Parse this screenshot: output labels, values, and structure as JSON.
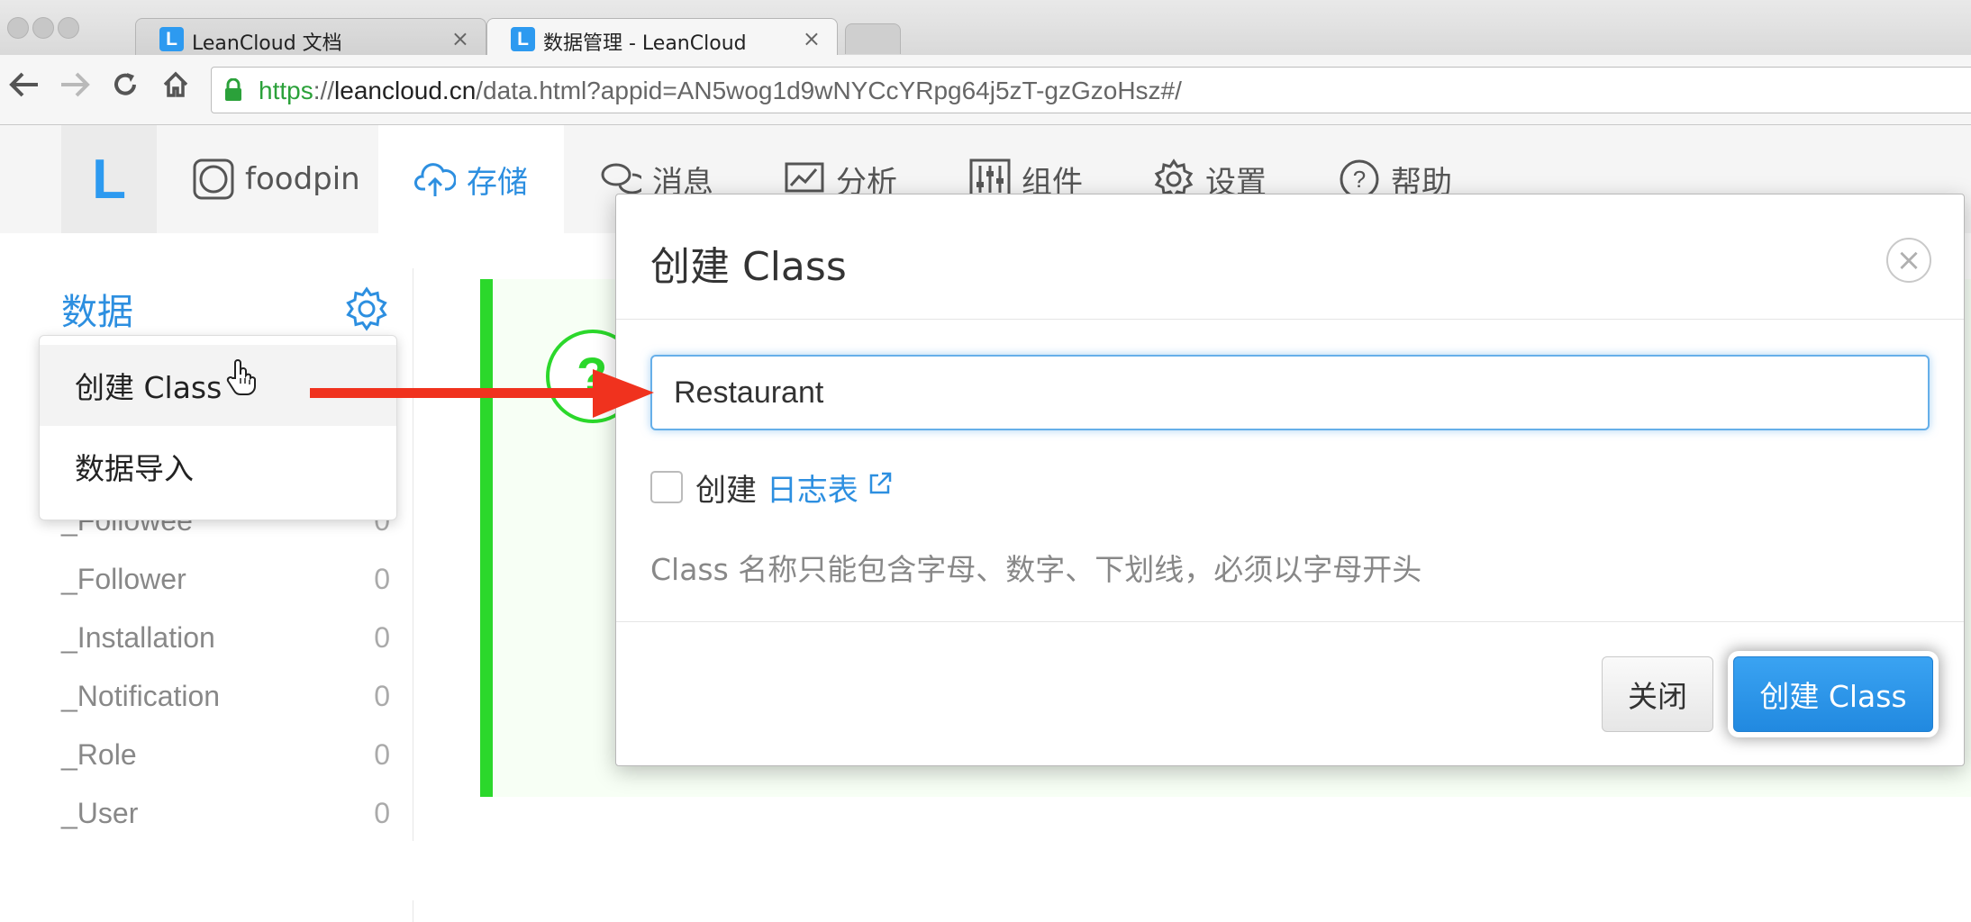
{
  "browser": {
    "tabs": [
      {
        "favicon": "L",
        "title": "LeanCloud 文档",
        "close": "×"
      },
      {
        "favicon": "L",
        "title": "数据管理 - LeanCloud",
        "close": "×"
      }
    ],
    "url": {
      "scheme": "https",
      "sep": "://",
      "host": "leancloud.cn",
      "path": "/data.html?appid=AN5wog1d9wNYCcYRpg64j5zT-gzGzoHsz#/"
    }
  },
  "appnav": {
    "logo": "L",
    "items": [
      {
        "label": "foodpin",
        "icon": "app-icon"
      },
      {
        "label": "存储",
        "icon": "cloud-upload-icon"
      },
      {
        "label": "消息",
        "icon": "chat-icon"
      },
      {
        "label": "分析",
        "icon": "chart-icon"
      },
      {
        "label": "组件",
        "icon": "sliders-icon"
      },
      {
        "label": "设置",
        "icon": "gear-icon"
      },
      {
        "label": "帮助",
        "icon": "help-icon"
      }
    ]
  },
  "sidebar": {
    "title": "数据",
    "menu": {
      "create_class": "创建 Class",
      "data_import": "数据导入"
    },
    "classes": [
      {
        "name": "_Followee",
        "count": "0"
      },
      {
        "name": "_Follower",
        "count": "0"
      },
      {
        "name": "_Installation",
        "count": "0"
      },
      {
        "name": "_Notification",
        "count": "0"
      },
      {
        "name": "_Role",
        "count": "0"
      },
      {
        "name": "_User",
        "count": "0"
      }
    ]
  },
  "content": {
    "help_mark": "?"
  },
  "modal": {
    "title": "创建 Class",
    "close_glyph": "×",
    "input_value": "Restaurant",
    "checkbox_prefix": "创建",
    "checkbox_link": "日志表",
    "hint": "Class 名称只能包含字母、数字、下划线，必须以字母开头",
    "btn_close": "关闭",
    "btn_create": "创建 Class"
  },
  "colors": {
    "brand": "#2d8fe0",
    "annotation_arrow": "#f0321e",
    "annotation_green": "#2bd82b"
  }
}
